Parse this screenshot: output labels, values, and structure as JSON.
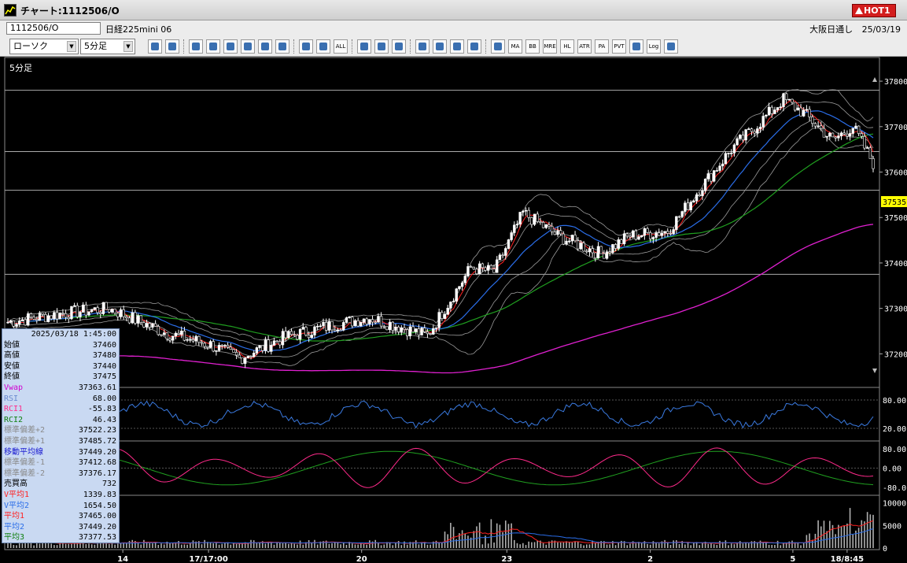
{
  "window": {
    "title": "チャート:1112506/O",
    "hot_label": "HOT1"
  },
  "symbol_bar": {
    "symbol": "1112506/O",
    "name": "日経225mini 06",
    "exchange": "大阪日通し",
    "date": "25/03/19"
  },
  "toolbar": {
    "chart_type": "ローソク",
    "interval": "5分足",
    "icons": [
      "zoom-icon",
      "grid-icon",
      "pen-icon",
      "eraser-icon",
      "cursor-icon",
      "undo-icon",
      "list-icon",
      "trash-icon",
      "bar-icon",
      "bar2-icon",
      "all-icon",
      "tools-icon",
      "wrench-icon",
      "palette-icon",
      "download-icon",
      "search-icon",
      "chart-icon",
      "compare-icon",
      "info-icon",
      "ma-icon",
      "bb-icon",
      "mre-icon",
      "hl-icon",
      "atr-icon",
      "pa-icon",
      "pvt-icon",
      "box-icon",
      "log-icon",
      "screen-icon"
    ],
    "icon_labels": {
      "all-icon": "ALL",
      "ma-icon": "MA",
      "bb-icon": "BB",
      "mre-icon": "MRE",
      "hl-icon": "HL",
      "atr-icon": "ATR",
      "pa-icon": "PA",
      "pvt-icon": "PVT",
      "log-icon": "Log"
    }
  },
  "chart_data": {
    "type": "candlestick",
    "interval_label": "5分足",
    "price_axis": {
      "min": 37140,
      "max": 37840,
      "ticks": [
        37200,
        37300,
        37400,
        37500,
        37600,
        37700,
        37800
      ],
      "current": 37535,
      "hlines": [
        37780,
        37645,
        37560,
        37375
      ]
    },
    "x_labels": [
      {
        "label": "14",
        "pos": 0.135
      },
      {
        "label": "17/17:00",
        "pos": 0.233
      },
      {
        "label": "20",
        "pos": 0.408
      },
      {
        "label": "23",
        "pos": 0.574
      },
      {
        "label": "2",
        "pos": 0.738
      },
      {
        "label": "5",
        "pos": 0.901
      },
      {
        "label": "18/8:45",
        "pos": 0.963
      }
    ],
    "rsi_axis": {
      "ticks": [
        "80.00",
        "20.00"
      ]
    },
    "rci_axis": {
      "ticks": [
        "80.00",
        "0.00",
        "-80.0"
      ]
    },
    "volume_axis": {
      "ticks": [
        "10000",
        "5000",
        "0"
      ]
    },
    "series_colors": {
      "up": "#ffffff",
      "down": "#000000",
      "ma_short": "#ff2020",
      "ma_mid": "#2a6de8",
      "ma_long": "#20a020",
      "vwap": "#e020d0",
      "bands": "#9a9a9a",
      "rsi": "#3a7ae0",
      "rci1": "#ff2a8a",
      "rci2": "#20a020",
      "volume": "#b0b0b0"
    }
  },
  "info_panel": {
    "timestamp": "2025/03/18  1:45:00",
    "rows": [
      {
        "k": "始値",
        "v": "37460",
        "color": "#000000"
      },
      {
        "k": "高値",
        "v": "37480",
        "color": "#000000"
      },
      {
        "k": "安値",
        "v": "37440",
        "color": "#000000"
      },
      {
        "k": "終値",
        "v": "37475",
        "color": "#000000"
      },
      {
        "k": "Vwap",
        "v": "37363.61",
        "color": "#d000d0"
      },
      {
        "k": "RSI",
        "v": "68.00",
        "color": "#6a8ad0"
      },
      {
        "k": "RCI1",
        "v": "-55.83",
        "color": "#ff2a8a"
      },
      {
        "k": "RCI2",
        "v": "46.43",
        "color": "#108010"
      },
      {
        "k": "標準偏差+2",
        "v": "37522.23",
        "color": "#8a8a8a"
      },
      {
        "k": "標準偏差+1",
        "v": "37485.72",
        "color": "#8a8a8a"
      },
      {
        "k": "移動平均線",
        "v": "37449.20",
        "color": "#1a1ad0"
      },
      {
        "k": "標準偏差-1",
        "v": "37412.68",
        "color": "#8a8a8a"
      },
      {
        "k": "標準偏差-2",
        "v": "37376.17",
        "color": "#8a8a8a"
      },
      {
        "k": "売買高",
        "v": "732",
        "color": "#000000"
      },
      {
        "k": "V平均1",
        "v": "1339.83",
        "color": "#ff2020"
      },
      {
        "k": "V平均2",
        "v": "1654.50",
        "color": "#2a6de8"
      },
      {
        "k": "平均1",
        "v": "37465.00",
        "color": "#ff2020"
      },
      {
        "k": "平均2",
        "v": "37449.20",
        "color": "#2a6de8"
      },
      {
        "k": "平均3",
        "v": "37377.53",
        "color": "#108010"
      }
    ]
  }
}
